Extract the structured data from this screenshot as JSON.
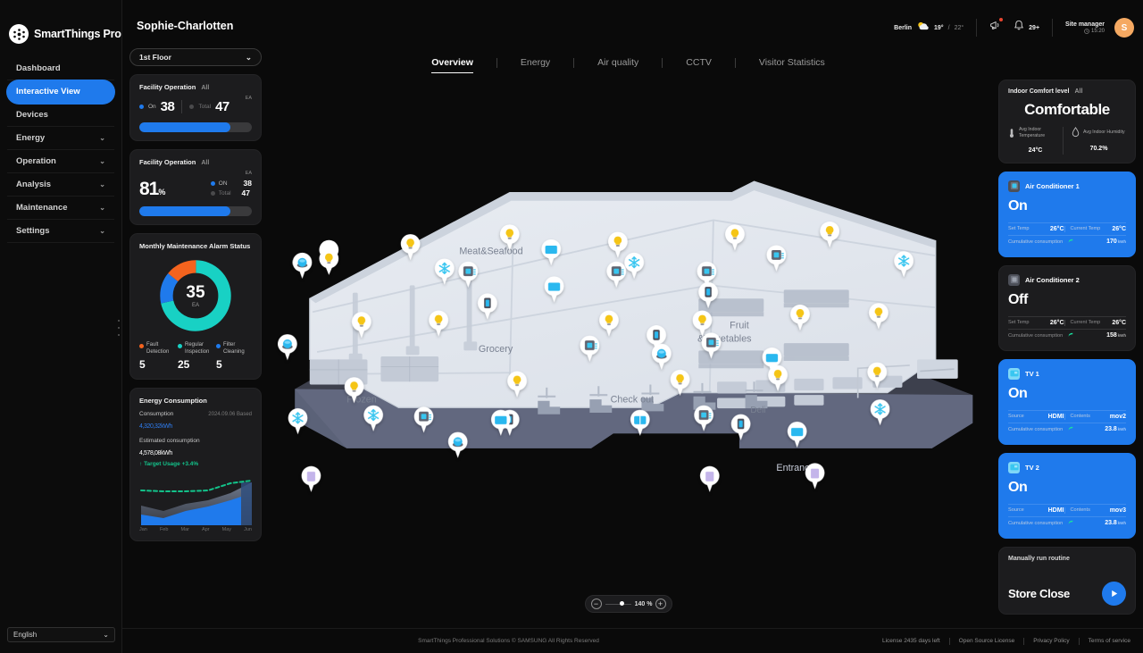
{
  "brand": {
    "name": "SmartThings Pro",
    "logo_icon": "smartthings-logo-icon"
  },
  "sidebar": {
    "items": [
      {
        "label": "Dashboard",
        "expandable": false,
        "active": false
      },
      {
        "label": "Interactive View",
        "expandable": false,
        "active": true
      },
      {
        "label": "Devices",
        "expandable": false,
        "active": false
      },
      {
        "label": "Energy",
        "expandable": true,
        "active": false
      },
      {
        "label": "Operation",
        "expandable": true,
        "active": false
      },
      {
        "label": "Analysis",
        "expandable": true,
        "active": false
      },
      {
        "label": "Maintenance",
        "expandable": true,
        "active": false
      },
      {
        "label": "Settings",
        "expandable": true,
        "active": false
      }
    ],
    "language": "English"
  },
  "header": {
    "page_title": "Sophie-Charlotten",
    "weather": {
      "city": "Berlin",
      "icon": "partly-cloudy-icon",
      "temp_now": "19°",
      "temp_sep": "/",
      "temp_high": "22°"
    },
    "announce_icon": "megaphone-icon",
    "notification_icon": "bell-icon",
    "notification_count": "29+",
    "role": "Site manager",
    "time": "15:20",
    "avatar_initial": "S"
  },
  "floor_select": {
    "value": "1st Floor",
    "chevron": "chevron-down-icon"
  },
  "cards": {
    "facility_count": {
      "title": "Facility Operation",
      "scope": "All",
      "unit": "EA",
      "on_label": "On",
      "on_value": "38",
      "total_label": "Total",
      "total_value": "47",
      "bar_percent": 81
    },
    "facility_pct": {
      "title": "Facility Operation",
      "scope": "All",
      "unit": "EA",
      "percent": "81",
      "percent_symbol": "%",
      "on_label": "ON",
      "on_value": "38",
      "total_label": "Total",
      "total_value": "47",
      "bar_percent": 81
    },
    "maintenance": {
      "title": "Monthly Maintenance Alarm Status",
      "total": "35",
      "total_unit": "EA",
      "legend": [
        {
          "label": "Fault Detection",
          "value": "5",
          "color": "#f4631e"
        },
        {
          "label": "Regular Inspection",
          "value": "25",
          "color": "#18d1c4"
        },
        {
          "label": "Filter Cleaning",
          "value": "5",
          "color": "#1f7aec"
        }
      ]
    },
    "energy": {
      "title": "Energy Consumption",
      "consumption_label": "Consumption",
      "date_label": "2024.09.06 Based",
      "consumption_value": "4,320,32",
      "consumption_unit": "kWh",
      "estimated_label": "Estimated consumption",
      "estimated_value": "4,578,08",
      "estimated_unit": "kWh",
      "target_text": "Target Usage +3.4%",
      "months": [
        "Jan",
        "Feb",
        "Mar",
        "Apr",
        "May",
        "Jun"
      ]
    }
  },
  "tabs": [
    {
      "label": "Overview",
      "active": true
    },
    {
      "label": "Energy",
      "active": false
    },
    {
      "label": "Air quality",
      "active": false
    },
    {
      "label": "CCTV",
      "active": false
    },
    {
      "label": "Visitor Statistics",
      "active": false
    }
  ],
  "floorplan": {
    "zones": [
      {
        "label": "Meat&Seafood"
      },
      {
        "label": "Grocery"
      },
      {
        "label": "Fruit &Vegetables"
      },
      {
        "label": "Frozen"
      },
      {
        "label": "Check out"
      },
      {
        "label": "Deli"
      },
      {
        "label": "Entrance"
      }
    ]
  },
  "zoom_control": {
    "minus": "−",
    "plus": "+",
    "level": "140 %"
  },
  "right": {
    "comfort": {
      "title": "Indoor Comfort level",
      "scope": "All",
      "status": "Comfortable",
      "temperature": {
        "icon": "thermometer-icon",
        "label": "Avg Indoor Temperature",
        "value": "24",
        "unit": "°C"
      },
      "humidity": {
        "icon": "humidity-icon",
        "label": "Avg Indoor Humidity",
        "value": "70.2",
        "unit": "%"
      }
    },
    "devices": [
      {
        "name": "Air Conditioner 1",
        "icon": "air-conditioner-icon",
        "state": "On",
        "active": true,
        "row1": [
          {
            "k": "Set Temp",
            "v": "26",
            "unit": "°C"
          },
          {
            "k": "Current Temp",
            "v": "26",
            "unit": "°C"
          }
        ],
        "row2": {
          "k": "Cumulative consumption",
          "v": "170",
          "unit": "kWh"
        }
      },
      {
        "name": "Air Conditioner 2",
        "icon": "air-conditioner-icon",
        "state": "Off",
        "active": false,
        "row1": [
          {
            "k": "Set Temp",
            "v": "26",
            "unit": "°C"
          },
          {
            "k": "Current Temp",
            "v": "26",
            "unit": "°C"
          }
        ],
        "row2": {
          "k": "Cumulative consumption",
          "v": "158",
          "unit": "kWh"
        }
      },
      {
        "name": "TV 1",
        "icon": "tv-icon",
        "state": "On",
        "active": true,
        "row1": [
          {
            "k": "Source",
            "v": "HDMI",
            "unit": ""
          },
          {
            "k": "Contents",
            "v": "mov2",
            "unit": ""
          }
        ],
        "row2": {
          "k": "Cumulative consumption",
          "v": "23.8",
          "unit": "kWh"
        }
      },
      {
        "name": "TV 2",
        "icon": "tv-icon",
        "state": "On",
        "active": true,
        "row1": [
          {
            "k": "Source",
            "v": "HDMI",
            "unit": ""
          },
          {
            "k": "Contents",
            "v": "mov3",
            "unit": ""
          }
        ],
        "row2": {
          "k": "Cumulative consumption",
          "v": "23.8",
          "unit": "kWh"
        }
      }
    ],
    "routine": {
      "title": "Manually run routine",
      "name": "Store Close",
      "play_icon": "play-icon"
    }
  },
  "footer": {
    "copyright": "SmartThings Professional Solutions © SAMSUNG All Rights Reserved",
    "links": [
      "License 2435 days left",
      "Open Source License",
      "Privacy Policy",
      "Terms of service"
    ]
  },
  "chart_data": {
    "type": "area",
    "title": "Energy Consumption",
    "categories": [
      "Jan",
      "Feb",
      "Mar",
      "Apr",
      "May",
      "Jun"
    ],
    "series": [
      {
        "name": "Consumption",
        "values": [
          22,
          18,
          30,
          38,
          48,
          62
        ],
        "color": "#1f7aec"
      },
      {
        "name": "Estimated",
        "values": [
          38,
          30,
          40,
          46,
          58,
          74
        ],
        "color": "#6e7a93"
      },
      {
        "name": "Target Usage",
        "values": [
          66,
          66,
          66,
          66,
          74,
          80
        ],
        "color": "#13c28a",
        "style": "dashed"
      }
    ],
    "ylim": [
      0,
      100
    ],
    "grid": false,
    "legend": "none"
  }
}
